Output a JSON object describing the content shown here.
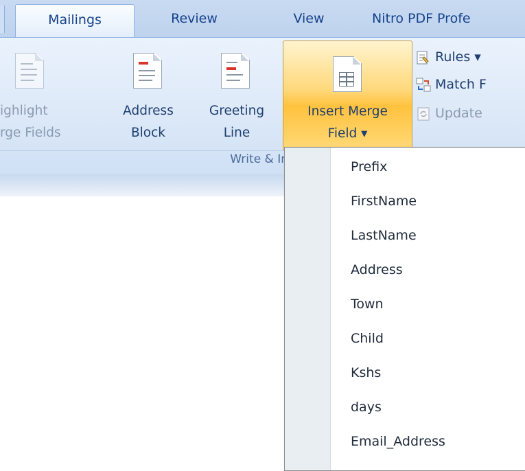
{
  "tabs": [
    "Mailings",
    "Review",
    "View",
    "Nitro PDF Profe"
  ],
  "active_tab": "Mailings",
  "ribbon": {
    "highlight": {
      "line1": "ighlight",
      "line2": "rge Fields"
    },
    "address_block": {
      "line1": "Address",
      "line2": "Block"
    },
    "greeting_line": {
      "line1": "Greeting",
      "line2": "Line"
    },
    "insert_merge": {
      "line1": "Insert Merge",
      "line2": "Field ▾"
    },
    "rules": "Rules ▾",
    "match": "Match F",
    "update": "Update",
    "group_label": "Write & In"
  },
  "menu": {
    "items": [
      "Prefix",
      "FirstName",
      "LastName",
      "Address",
      "Town",
      "Child",
      "Kshs",
      "days",
      "Email_Address"
    ]
  },
  "colors": {
    "accent": "#15428b",
    "highlight": "#ffd87a"
  }
}
